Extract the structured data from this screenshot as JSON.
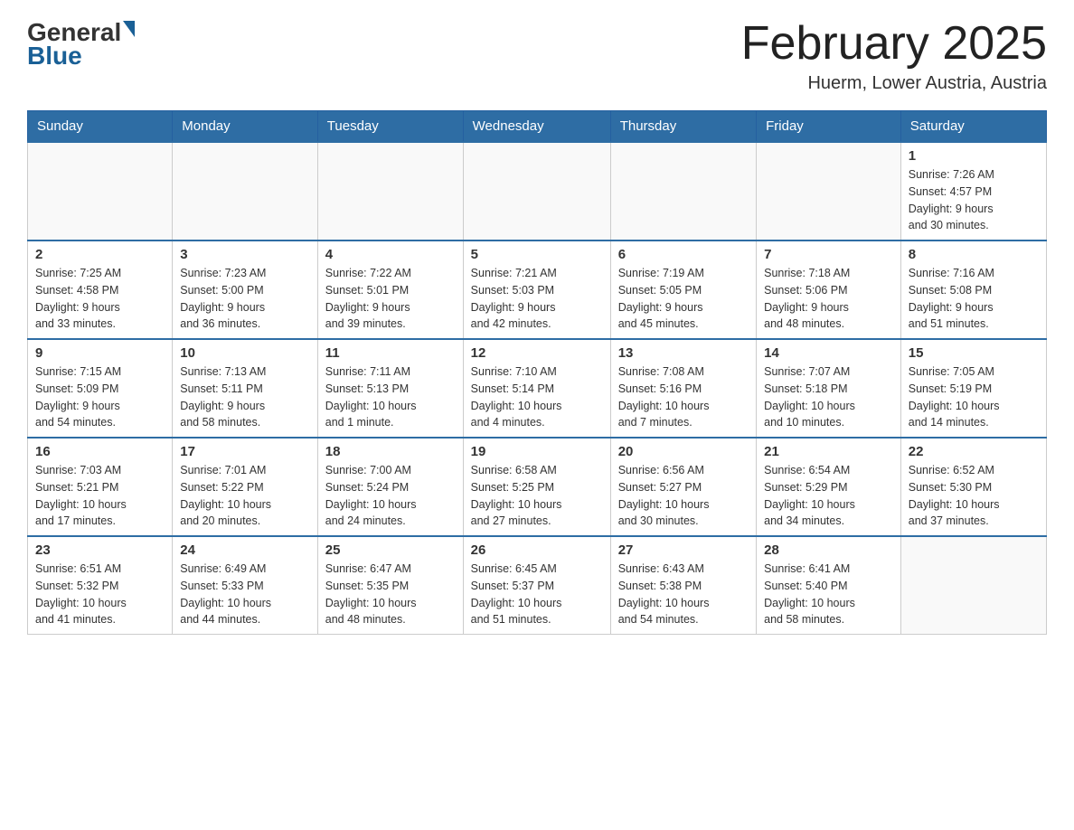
{
  "header": {
    "logo_general": "General",
    "logo_blue": "Blue",
    "title": "February 2025",
    "location": "Huerm, Lower Austria, Austria"
  },
  "days_of_week": [
    "Sunday",
    "Monday",
    "Tuesday",
    "Wednesday",
    "Thursday",
    "Friday",
    "Saturday"
  ],
  "weeks": [
    [
      {
        "day": "",
        "info": ""
      },
      {
        "day": "",
        "info": ""
      },
      {
        "day": "",
        "info": ""
      },
      {
        "day": "",
        "info": ""
      },
      {
        "day": "",
        "info": ""
      },
      {
        "day": "",
        "info": ""
      },
      {
        "day": "1",
        "info": "Sunrise: 7:26 AM\nSunset: 4:57 PM\nDaylight: 9 hours\nand 30 minutes."
      }
    ],
    [
      {
        "day": "2",
        "info": "Sunrise: 7:25 AM\nSunset: 4:58 PM\nDaylight: 9 hours\nand 33 minutes."
      },
      {
        "day": "3",
        "info": "Sunrise: 7:23 AM\nSunset: 5:00 PM\nDaylight: 9 hours\nand 36 minutes."
      },
      {
        "day": "4",
        "info": "Sunrise: 7:22 AM\nSunset: 5:01 PM\nDaylight: 9 hours\nand 39 minutes."
      },
      {
        "day": "5",
        "info": "Sunrise: 7:21 AM\nSunset: 5:03 PM\nDaylight: 9 hours\nand 42 minutes."
      },
      {
        "day": "6",
        "info": "Sunrise: 7:19 AM\nSunset: 5:05 PM\nDaylight: 9 hours\nand 45 minutes."
      },
      {
        "day": "7",
        "info": "Sunrise: 7:18 AM\nSunset: 5:06 PM\nDaylight: 9 hours\nand 48 minutes."
      },
      {
        "day": "8",
        "info": "Sunrise: 7:16 AM\nSunset: 5:08 PM\nDaylight: 9 hours\nand 51 minutes."
      }
    ],
    [
      {
        "day": "9",
        "info": "Sunrise: 7:15 AM\nSunset: 5:09 PM\nDaylight: 9 hours\nand 54 minutes."
      },
      {
        "day": "10",
        "info": "Sunrise: 7:13 AM\nSunset: 5:11 PM\nDaylight: 9 hours\nand 58 minutes."
      },
      {
        "day": "11",
        "info": "Sunrise: 7:11 AM\nSunset: 5:13 PM\nDaylight: 10 hours\nand 1 minute."
      },
      {
        "day": "12",
        "info": "Sunrise: 7:10 AM\nSunset: 5:14 PM\nDaylight: 10 hours\nand 4 minutes."
      },
      {
        "day": "13",
        "info": "Sunrise: 7:08 AM\nSunset: 5:16 PM\nDaylight: 10 hours\nand 7 minutes."
      },
      {
        "day": "14",
        "info": "Sunrise: 7:07 AM\nSunset: 5:18 PM\nDaylight: 10 hours\nand 10 minutes."
      },
      {
        "day": "15",
        "info": "Sunrise: 7:05 AM\nSunset: 5:19 PM\nDaylight: 10 hours\nand 14 minutes."
      }
    ],
    [
      {
        "day": "16",
        "info": "Sunrise: 7:03 AM\nSunset: 5:21 PM\nDaylight: 10 hours\nand 17 minutes."
      },
      {
        "day": "17",
        "info": "Sunrise: 7:01 AM\nSunset: 5:22 PM\nDaylight: 10 hours\nand 20 minutes."
      },
      {
        "day": "18",
        "info": "Sunrise: 7:00 AM\nSunset: 5:24 PM\nDaylight: 10 hours\nand 24 minutes."
      },
      {
        "day": "19",
        "info": "Sunrise: 6:58 AM\nSunset: 5:25 PM\nDaylight: 10 hours\nand 27 minutes."
      },
      {
        "day": "20",
        "info": "Sunrise: 6:56 AM\nSunset: 5:27 PM\nDaylight: 10 hours\nand 30 minutes."
      },
      {
        "day": "21",
        "info": "Sunrise: 6:54 AM\nSunset: 5:29 PM\nDaylight: 10 hours\nand 34 minutes."
      },
      {
        "day": "22",
        "info": "Sunrise: 6:52 AM\nSunset: 5:30 PM\nDaylight: 10 hours\nand 37 minutes."
      }
    ],
    [
      {
        "day": "23",
        "info": "Sunrise: 6:51 AM\nSunset: 5:32 PM\nDaylight: 10 hours\nand 41 minutes."
      },
      {
        "day": "24",
        "info": "Sunrise: 6:49 AM\nSunset: 5:33 PM\nDaylight: 10 hours\nand 44 minutes."
      },
      {
        "day": "25",
        "info": "Sunrise: 6:47 AM\nSunset: 5:35 PM\nDaylight: 10 hours\nand 48 minutes."
      },
      {
        "day": "26",
        "info": "Sunrise: 6:45 AM\nSunset: 5:37 PM\nDaylight: 10 hours\nand 51 minutes."
      },
      {
        "day": "27",
        "info": "Sunrise: 6:43 AM\nSunset: 5:38 PM\nDaylight: 10 hours\nand 54 minutes."
      },
      {
        "day": "28",
        "info": "Sunrise: 6:41 AM\nSunset: 5:40 PM\nDaylight: 10 hours\nand 58 minutes."
      },
      {
        "day": "",
        "info": ""
      }
    ]
  ]
}
